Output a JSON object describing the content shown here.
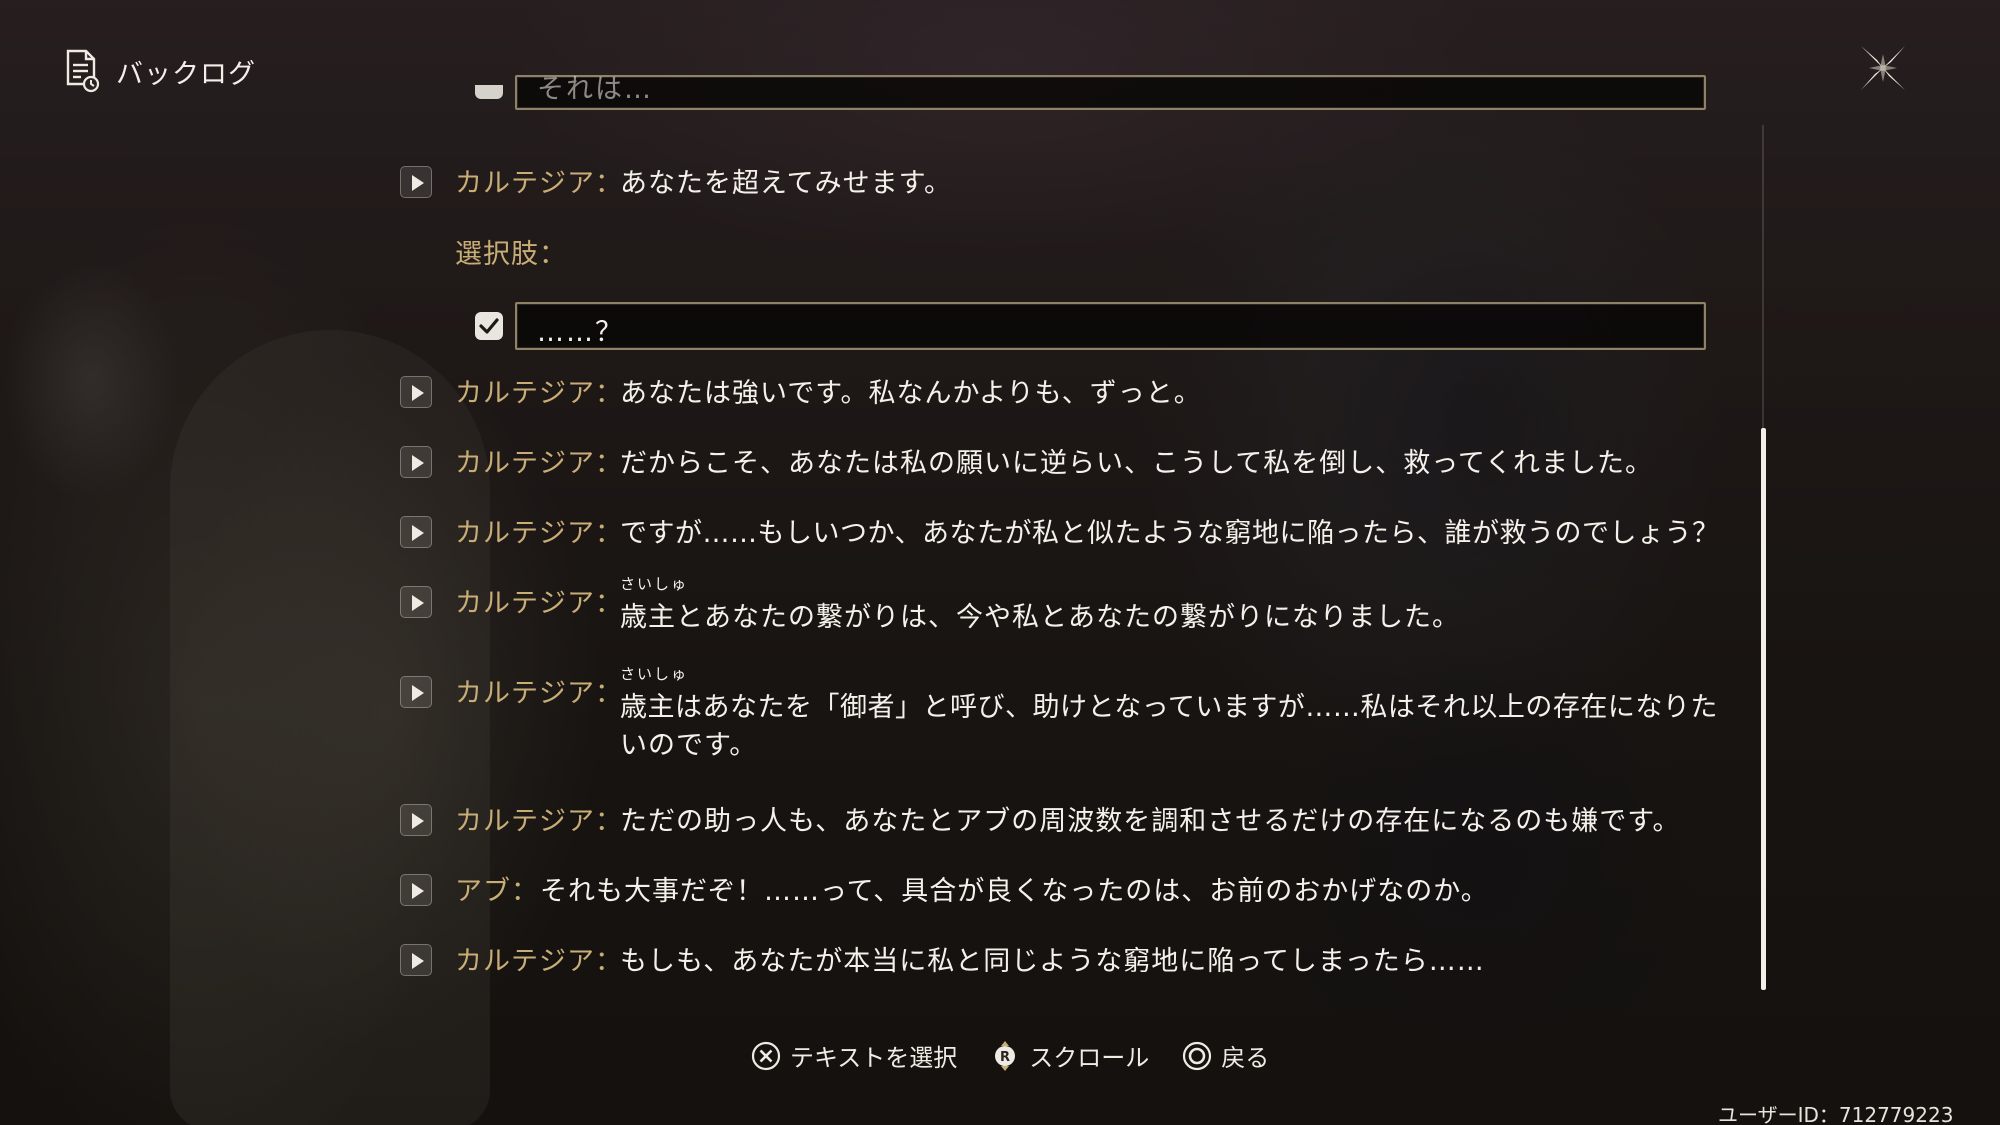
{
  "header": {
    "title": "バックログ",
    "icon": "backlog-document-icon"
  },
  "close_button": {
    "icon": "close-cross-icon"
  },
  "partial_choice": {
    "text": "それは…"
  },
  "entries_top": [
    {
      "speaker": "カルテジア：",
      "text": "あなたを超えてみせます。"
    }
  ],
  "choice_section": {
    "label": "選択肢：",
    "choice_text": "……？",
    "checked": true
  },
  "entries": [
    {
      "speaker": "カルテジア：",
      "text": "あなたは強いです。私なんかよりも、ずっと。"
    },
    {
      "speaker": "カルテジア：",
      "text": "だからこそ、あなたは私の願いに逆らい、こうして私を倒し、救ってくれました。"
    },
    {
      "speaker": "カルテジア：",
      "text": "ですが……もしいつか、あなたが私と似たような窮地に陥ったら、誰が救うのでしょう？"
    },
    {
      "speaker": "カルテジア：",
      "ruby": "さいしゅ",
      "text": "歳主とあなたの繋がりは、今や私とあなたの繋がりになりました。"
    },
    {
      "speaker": "カルテジア：",
      "ruby": "さいしゅ",
      "text": "歳主はあなたを「御者」と呼び、助けとなっていますが……私はそれ以上の存在になりた",
      "text2": "いのです。"
    },
    {
      "speaker": "カルテジア：",
      "text": "ただの助っ人も、あなたとアブの周波数を調和させるだけの存在になるのも嫌です。"
    },
    {
      "speaker": "アブ：",
      "text": "それも大事だぞ！……って、具合が良くなったのは、お前のおかげなのか。"
    },
    {
      "speaker": "カルテジア：",
      "text": "もしも、あなたが本当に私と同じような窮地に陥ってしまったら……"
    }
  ],
  "footer": {
    "hints": [
      {
        "icon": "cross-button-icon",
        "label": "テキストを選択"
      },
      {
        "icon": "right-stick-icon",
        "label": "スクロール"
      },
      {
        "icon": "circle-button-icon",
        "label": "戻る"
      }
    ],
    "user_id": "ユーザーID：712779223"
  },
  "colors": {
    "speaker": "#c9ad77",
    "text": "#f4f1ea",
    "choice_border": "#8f8367"
  }
}
